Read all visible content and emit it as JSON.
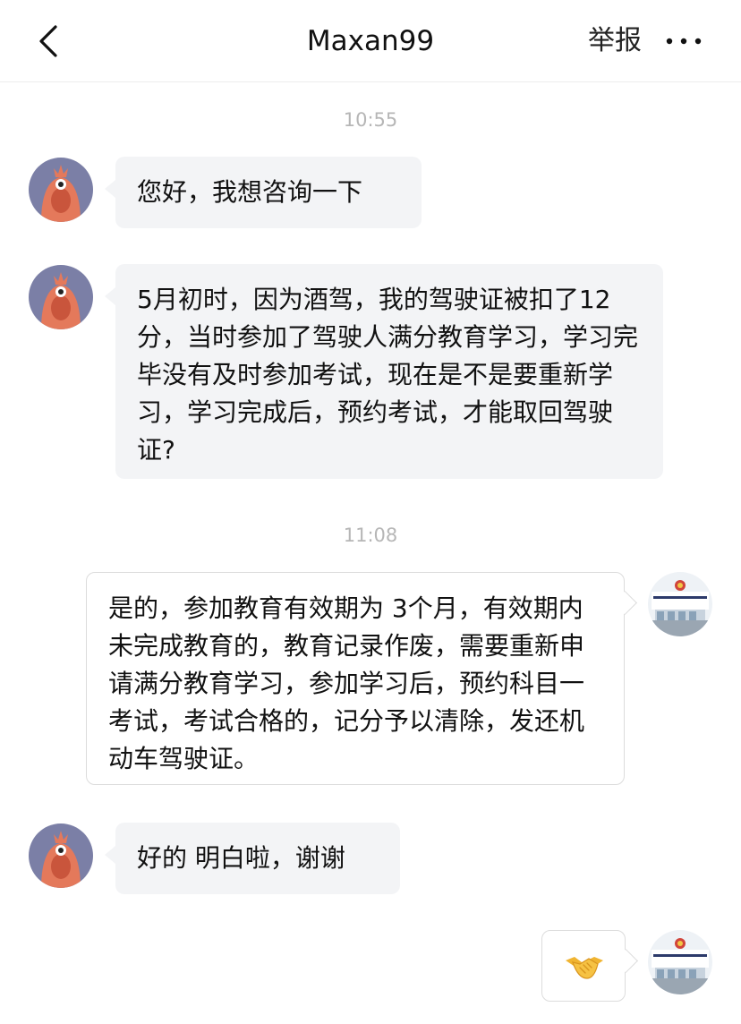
{
  "header": {
    "title": "Maxan99",
    "report_label": "举报",
    "back_icon": "chevron-left-icon",
    "more_icon": "more-dots-icon"
  },
  "colors": {
    "avatar_bg": "#7b7fa6",
    "avatar_shrimp": "#e4795b",
    "bubble_incoming": "#f3f4f6",
    "timestamp": "#b6b6b6"
  },
  "chat": {
    "timestamps": [
      "10:55",
      "11:08"
    ],
    "messages": [
      {
        "from": "user",
        "text": "您好，我想咨询一下"
      },
      {
        "from": "user",
        "text": "5月初时，因为酒驾，我的驾驶证被扣了12分，当时参加了驾驶人满分教育学习，学习完毕没有及时参加考试，现在是不是要重新学习，学习完成后，预约考试，才能取回驾驶证?"
      },
      {
        "from": "official",
        "text": "是的，参加教育有效期为 3个月，有效期内未完成教育的，教育记录作废，需要重新申请满分教育学习，参加学习后，预约科目一考试，考试合格的，记分予以清除，发还机动车驾驶证。"
      },
      {
        "from": "user",
        "text": "好的 明白啦，谢谢"
      },
      {
        "from": "official",
        "sticker": "handshake-emoji"
      }
    ]
  }
}
